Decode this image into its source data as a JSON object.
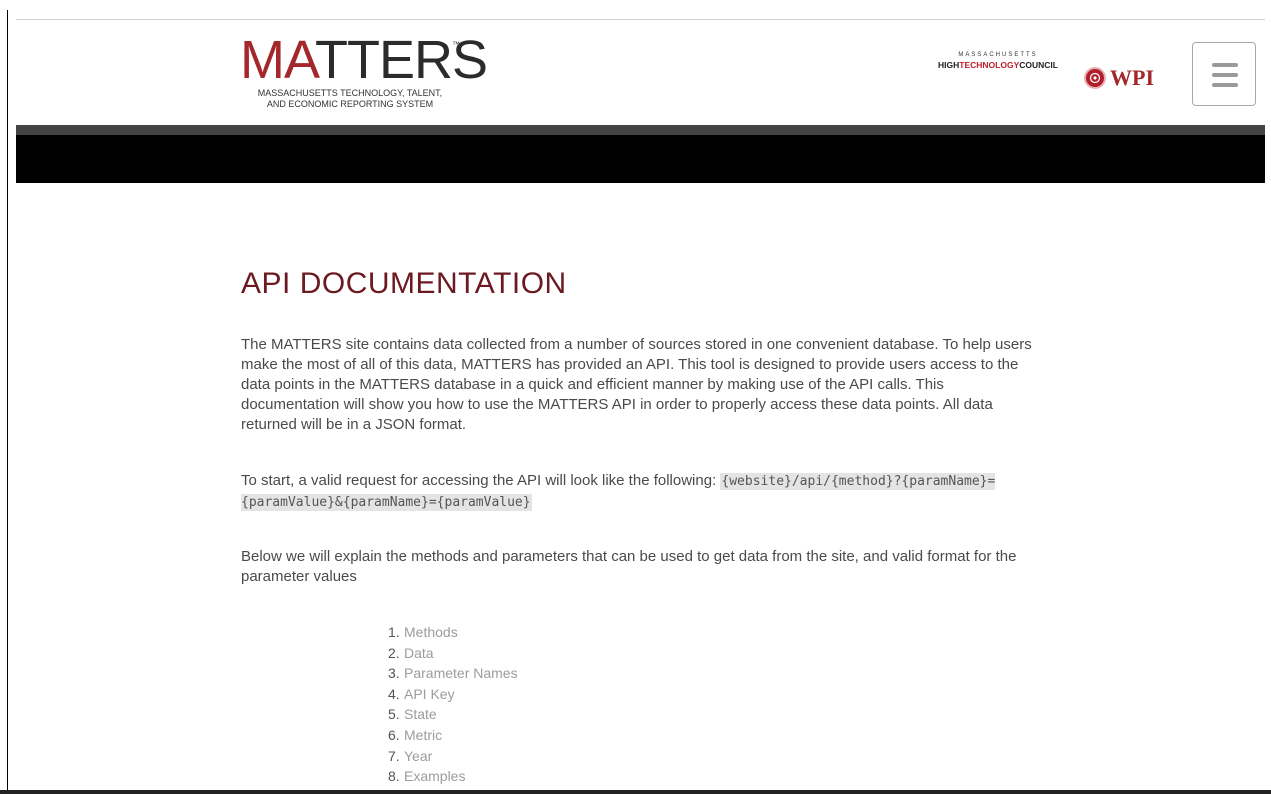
{
  "logo": {
    "wordmark_a": "MA",
    "wordmark_b": "TTERS",
    "tm": "™",
    "tagline_line1": "MASSACHUSETTS TECHNOLOGY, TALENT,",
    "tagline_line2": "AND ECONOMIC REPORTING SYSTEM"
  },
  "partners": {
    "mhtc_top": "MASSACHUSETTS",
    "mhtc_high": "HIGH",
    "mhtc_tech": "TECHNOLOGY",
    "mhtc_council": "COUNCIL",
    "wpi_text": "WPI"
  },
  "colors": {
    "brand_red": "#a4282b",
    "title_maroon": "#6b1a21",
    "link_gray": "#9c9c9c"
  },
  "icons": {
    "menu": "hamburger-icon",
    "wpi_seal": "seal-icon"
  },
  "page": {
    "title": "API DOCUMENTATION",
    "intro": "The MATTERS site contains data collected from a number of sources stored in one convenient database. To help users make the most of all of this data, MATTERS has provided an API. This tool is designed to provide users access to the data points in the MATTERS database in a quick and efficient manner by making use of the API calls. This documentation will show you how to use the MATTERS API in order to properly access these data points. All data returned will be in a JSON format.",
    "request_prefix": "To start, a valid request for accessing the API will look like the following: ",
    "request_code": "{website}/api/{method}?{paramName}={paramValue}&{paramName}={paramValue}",
    "explain": "Below we will explain the methods and parameters that can be used to get data from the site, and valid format for the parameter values"
  },
  "toc": [
    {
      "num": "1.",
      "label": "Methods"
    },
    {
      "num": "2.",
      "label": "Data"
    },
    {
      "num": "3.",
      "label": "Parameter Names"
    },
    {
      "num": "4.",
      "label": "API Key"
    },
    {
      "num": "5.",
      "label": "State"
    },
    {
      "num": "6.",
      "label": "Metric"
    },
    {
      "num": "7.",
      "label": "Year"
    },
    {
      "num": "8.",
      "label": "Examples"
    }
  ]
}
